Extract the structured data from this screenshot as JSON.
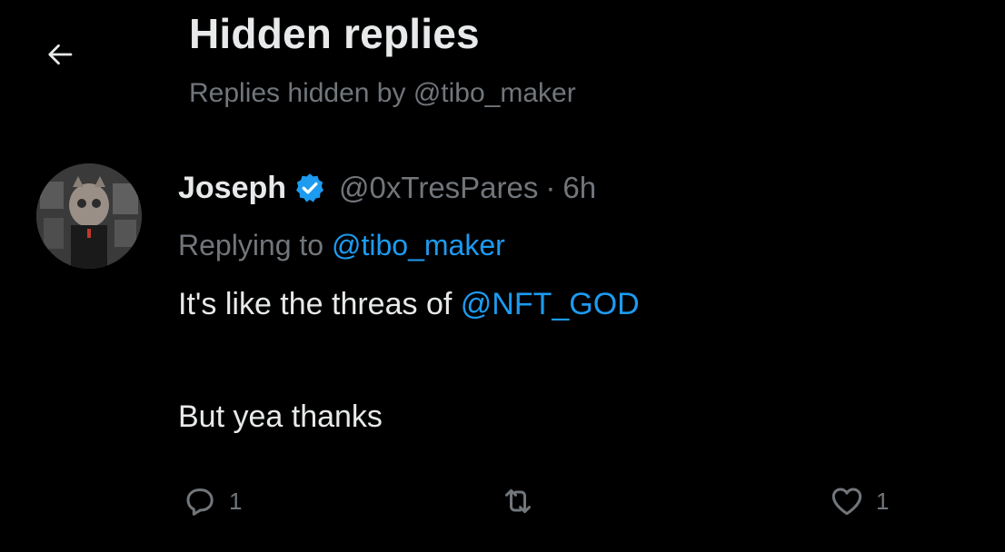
{
  "header": {
    "title": "Hidden replies",
    "subtitle": "Replies hidden by @tibo_maker",
    "back_icon": "arrow-left-icon"
  },
  "tweet": {
    "author_name": "Joseph",
    "verified": true,
    "verified_icon": "verified-badge-icon",
    "handle": "@0xTresPares",
    "separator": "·",
    "time": "6h",
    "replying_prefix": "Replying to",
    "replying_to": "@tibo_maker",
    "text_before_mention": "It's like the threas of",
    "text_mention": "@NFT_GOD",
    "text_line2": "But yea thanks"
  },
  "actions": {
    "reply": {
      "icon": "reply-icon",
      "count": "1"
    },
    "retweet": {
      "icon": "retweet-icon",
      "count": ""
    },
    "like": {
      "icon": "heart-icon",
      "count": "1"
    }
  },
  "colors": {
    "background": "#000000",
    "text_primary": "#e7e9ea",
    "text_secondary": "#71767b",
    "accent": "#1d9bf0"
  }
}
